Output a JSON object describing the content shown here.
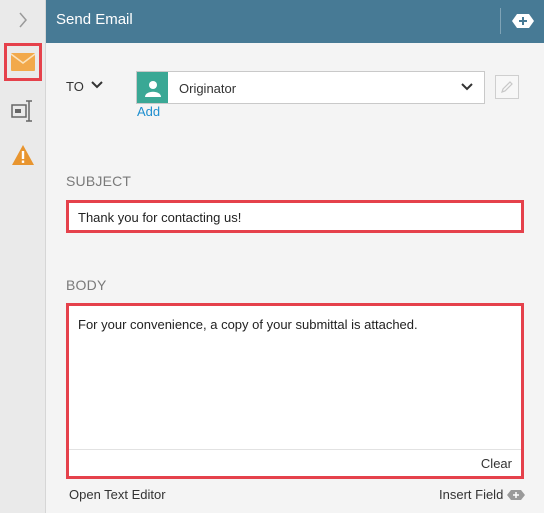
{
  "header": {
    "title": "Send Email"
  },
  "to": {
    "label": "TO",
    "recipient": "Originator",
    "add_label": "Add"
  },
  "subject": {
    "label": "SUBJECT",
    "value": "Thank you for contacting us!"
  },
  "body": {
    "label": "BODY",
    "value": "For your convenience, a copy of your submittal is attached.",
    "clear_label": "Clear"
  },
  "footer": {
    "open_editor_label": "Open Text Editor",
    "insert_field_label": "Insert Field"
  },
  "colors": {
    "header": "#477a95",
    "accent_red": "#e5414b",
    "avatar": "#3aa895",
    "link": "#1f8fcf",
    "email_icon": "#f2a94b",
    "warning_icon": "#e8952f"
  },
  "icons": [
    "chevron-right-icon",
    "email-icon",
    "field-icon",
    "warning-icon",
    "add-icon",
    "chevron-down-icon",
    "user-icon",
    "pencil-icon",
    "insert-field-icon"
  ]
}
